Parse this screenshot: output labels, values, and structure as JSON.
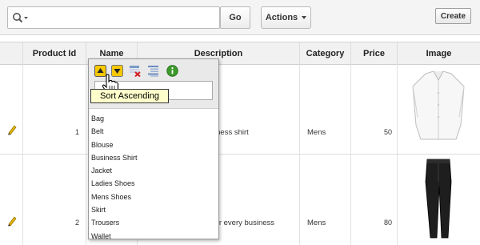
{
  "toolbar": {
    "search_value": "",
    "go_label": "Go",
    "actions_label": "Actions",
    "create_label": "Create"
  },
  "table": {
    "columns": [
      "Product Id",
      "Name",
      "Description",
      "Category",
      "Price",
      "Image"
    ],
    "rows": [
      {
        "product_id": "1",
        "description": "usiness shirt",
        "category": "Mens",
        "price": "50"
      },
      {
        "product_id": "2",
        "description": "e for every business",
        "category": "Mens",
        "price": "80"
      }
    ]
  },
  "popup": {
    "filter_value": "",
    "tooltip": "Sort Ascending",
    "tools": [
      "sort-ascending-icon",
      "sort-descending-icon",
      "remove-column-icon",
      "control-break-icon",
      "help-icon"
    ],
    "items": [
      "Bag",
      "Belt",
      "Blouse",
      "Business Shirt",
      "Jacket",
      "Ladies Shoes",
      "Mens Shoes",
      "Skirt",
      "Trousers",
      "Wallet"
    ]
  },
  "colors": {
    "tooltip_bg": "#ffffcc",
    "pencil": "#e8b800",
    "accent_yellow": "#f5c800"
  }
}
